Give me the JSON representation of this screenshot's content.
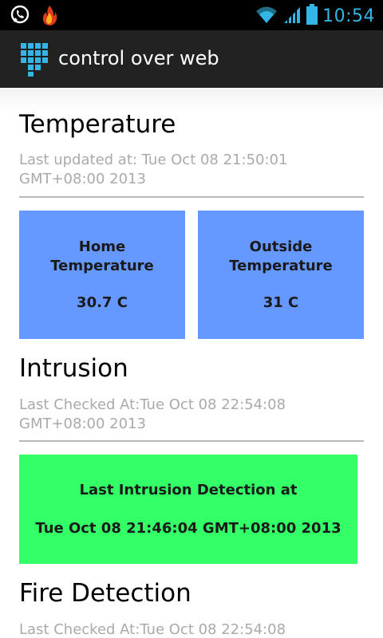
{
  "status_bar": {
    "time": "10:54",
    "icons": [
      "whatsapp-icon",
      "fire-app-icon",
      "wifi-icon",
      "signal-icon",
      "battery-icon"
    ]
  },
  "action_bar": {
    "title": "control over web",
    "icon": "keypad-grid-icon"
  },
  "temperature": {
    "title": "Temperature",
    "last_updated": "Last updated at: Tue Oct 08 21:50:01 GMT+08:00 2013",
    "home": {
      "label": "Home Temperature",
      "value": "30.7 C"
    },
    "outside": {
      "label": "Outside Temperature",
      "value": "31 C"
    }
  },
  "intrusion": {
    "title": "Intrusion",
    "last_checked": "Last Checked At:Tue Oct 08 22:54:08 GMT+08:00 2013",
    "detection_label": "Last Intrusion Detection at",
    "detection_time": "Tue Oct 08 21:46:04 GMT+08:00 2013"
  },
  "fire": {
    "title": "Fire Detection",
    "last_checked": "Last Checked At:Tue Oct 08 22:54:08"
  },
  "colors": {
    "tile_blue": "#6699ff",
    "alert_green": "#33ff66",
    "holo_blue": "#33b5e5",
    "action_bar": "#222222"
  }
}
